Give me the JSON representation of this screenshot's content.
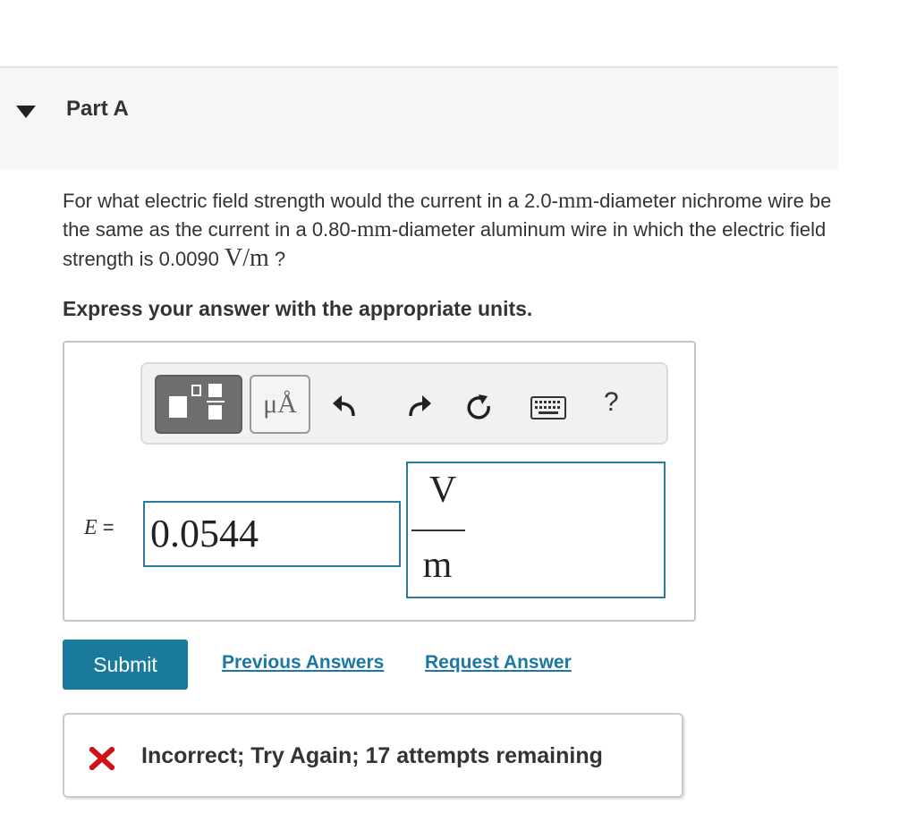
{
  "part": {
    "title": "Part A"
  },
  "question": {
    "text_1": "For what electric field strength would the current in a 2.0-",
    "unit_mm_1": "mm",
    "text_2": "-diameter nichrome wire be the same as the current in a 0.80-",
    "unit_mm_2": "mm",
    "text_3": "-diameter aluminum wire in which the electric field strength is 0.0090 ",
    "unit_vm": "V/m",
    "text_4": " ?"
  },
  "instructions": "Express your answer with the appropriate units.",
  "toolbar": {
    "units_label": "μÅ",
    "help_label": "?",
    "icons": [
      "templates-icon",
      "undo-icon",
      "redo-icon",
      "reset-icon",
      "keyboard-icon",
      "help-icon"
    ]
  },
  "answer": {
    "variable": "E",
    "equals": "=",
    "value": "0.0544",
    "unit_numerator": "V",
    "unit_denominator": "m"
  },
  "actions": {
    "submit_label": "Submit",
    "previous_answers_label": "Previous Answers",
    "request_answer_label": "Request Answer"
  },
  "feedback": {
    "text": "Incorrect; Try Again; 17 attempts remaining",
    "status_color": "#d0101a"
  },
  "colors": {
    "accent": "#1a7a9e",
    "link": "#1b78a2",
    "input_border": "#2b7aa0"
  }
}
